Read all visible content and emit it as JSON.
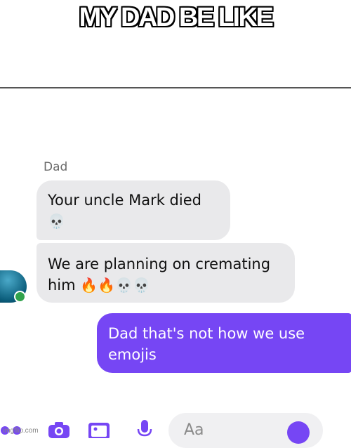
{
  "meme": {
    "caption": "MY DAD BE LIKE",
    "watermark": "imgflip.com"
  },
  "chat": {
    "sender_name": "Dad",
    "messages": [
      {
        "from": "Dad",
        "text": "Your uncle Mark died",
        "emojis": "💀"
      },
      {
        "from": "Dad",
        "text": "We are planning on cremating him",
        "emojis": "🔥🔥💀💀"
      },
      {
        "from": "me",
        "text": "Dad that's not how we use emojis"
      }
    ]
  },
  "composer": {
    "placeholder": "Aa",
    "icons": [
      "apps-icon",
      "camera-icon",
      "gallery-icon",
      "mic-icon",
      "emoji-icon"
    ]
  },
  "colors": {
    "outgoing_bubble": "#7646f4",
    "incoming_bubble": "#e9e9eb",
    "online_dot": "#31a24c"
  }
}
